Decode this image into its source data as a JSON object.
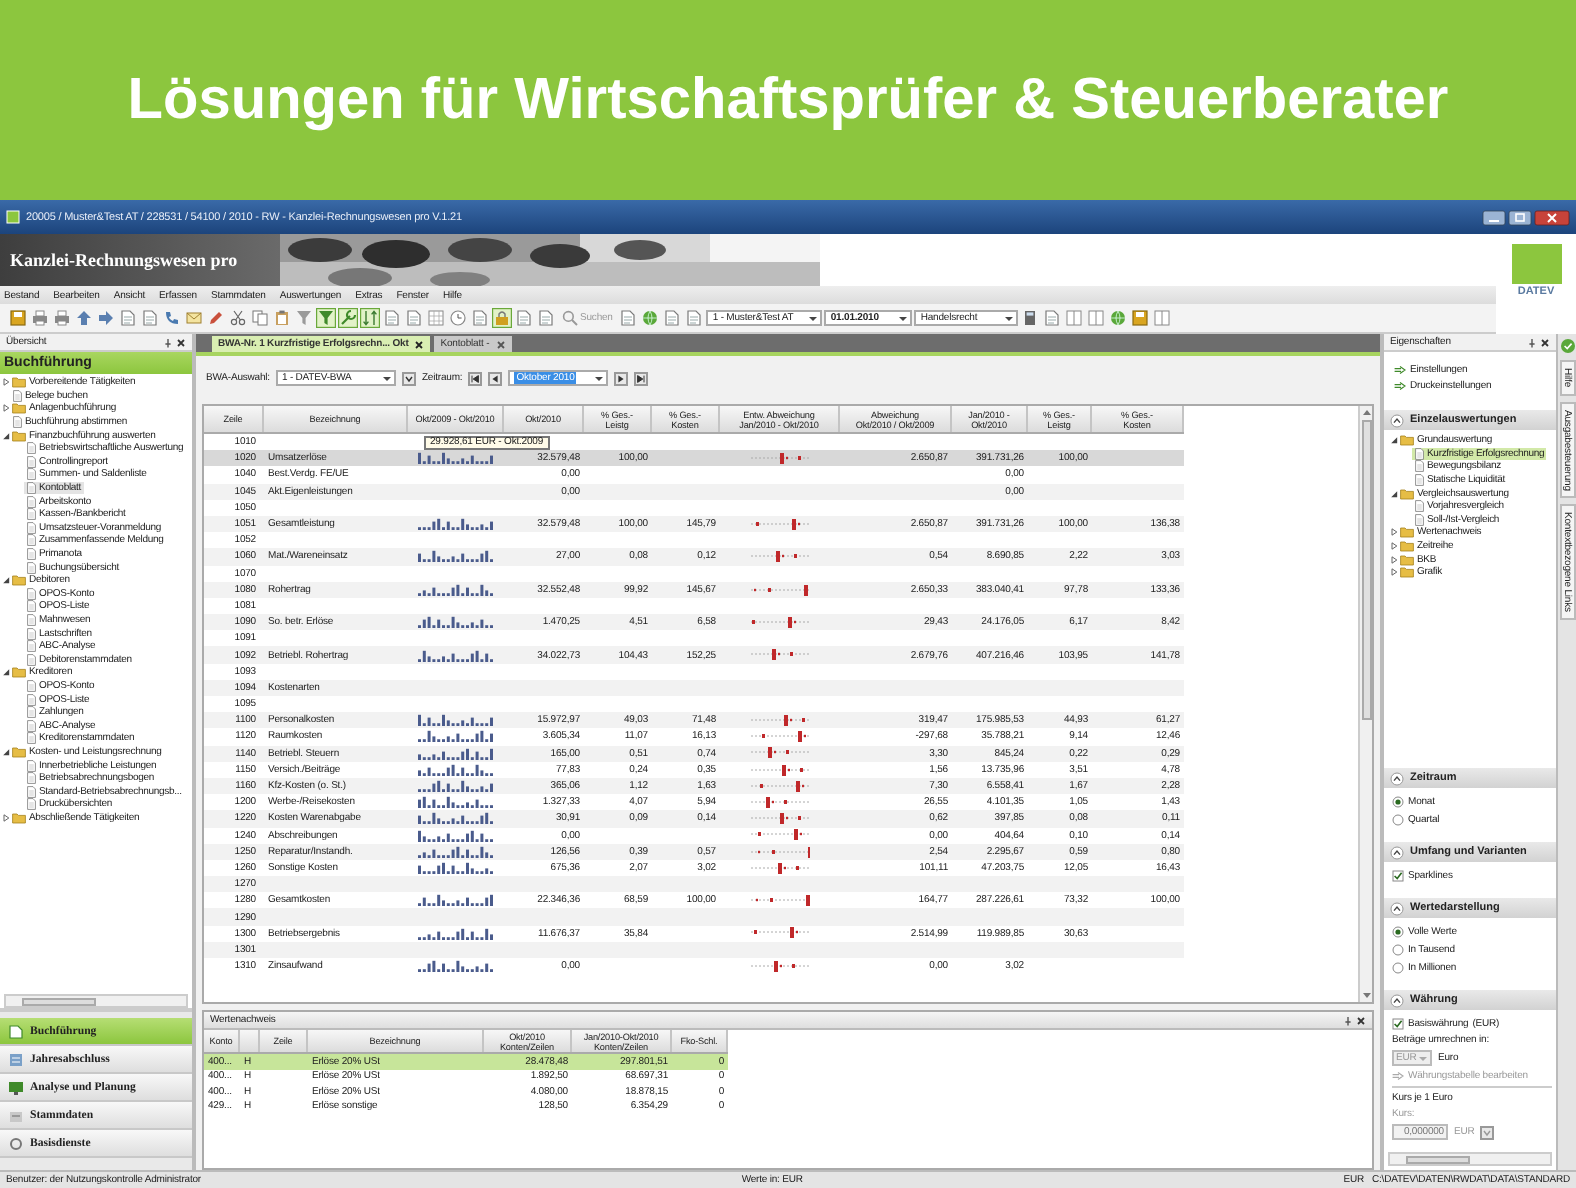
{
  "banner": {
    "title": "Lösungen für Wirtschaftsprüfer & Steuerberater"
  },
  "window": {
    "title": "20005 / Muster&Test AT / 228531 / 54100 / 2010 - RW - Kanzlei-Rechnungswesen pro V.1.21",
    "app_name": "Kanzlei-Rechnungswesen pro",
    "logo_text": "DATEV"
  },
  "menu": [
    "Bestand",
    "Bearbeiten",
    "Ansicht",
    "Erfassen",
    "Stammdaten",
    "Auswertungen",
    "Extras",
    "Fenster",
    "Hilfe"
  ],
  "toolbar": {
    "buttons_left": [
      {
        "on": false
      },
      {
        "on": false
      },
      {
        "on": false
      },
      {
        "on": false
      },
      {
        "on": false
      },
      {
        "on": false
      },
      {
        "on": false
      },
      {
        "on": false
      },
      {
        "on": false
      },
      {
        "on": false
      },
      {
        "on": false
      },
      {
        "on": false
      },
      {
        "on": false
      },
      {
        "on": false
      },
      {
        "on": true
      },
      {
        "on": true
      },
      {
        "on": true
      },
      {
        "on": false
      },
      {
        "on": false
      },
      {
        "on": false
      },
      {
        "on": false
      },
      {
        "on": false
      },
      {
        "on": true
      },
      {
        "on": false
      },
      {
        "on": false
      }
    ],
    "search": "Suchen",
    "buttons_mid": [
      {
        "on": false
      },
      {
        "on": false
      },
      {
        "on": false
      },
      {
        "on": false
      }
    ],
    "combos": [
      "1 - Muster&Test AT",
      "01.01.2010",
      "Handelsrecht"
    ],
    "buttons_right": [
      {
        "on": false
      },
      {
        "on": false
      },
      {
        "on": false
      },
      {
        "on": false
      },
      {
        "on": false
      },
      {
        "on": false
      },
      {
        "on": false
      }
    ]
  },
  "overview": {
    "title": "Übersicht",
    "section": "Buchführung",
    "tree": [
      {
        "label": "Vorbereitende Tätigkeiten",
        "kind": "folder",
        "expanded": false,
        "selected": false
      },
      {
        "label": "Belege buchen",
        "kind": "document",
        "selected": false
      },
      {
        "label": "Anlagenbuchführung",
        "kind": "folder",
        "expanded": false,
        "selected": false
      },
      {
        "label": "Buchführung abstimmen",
        "kind": "document",
        "selected": false
      },
      {
        "label": "Finanzbuchführung auswerten",
        "kind": "folder",
        "expanded": true,
        "selected": false,
        "children": [
          {
            "label": "Betriebswirtschaftliche Auswertung",
            "kind": "document",
            "selected": false
          },
          {
            "label": "Controllingreport",
            "kind": "document",
            "selected": false
          },
          {
            "label": "Summen- und Saldenliste",
            "kind": "document",
            "selected": false
          },
          {
            "label": "Kontoblatt",
            "kind": "document",
            "selected": true
          },
          {
            "label": "Arbeitskonto",
            "kind": "document",
            "selected": false
          },
          {
            "label": "Kassen-/Bankbericht",
            "kind": "document",
            "selected": false
          },
          {
            "label": "Umsatzsteuer-Voranmeldung",
            "kind": "document",
            "selected": false
          },
          {
            "label": "Zusammenfassende Meldung",
            "kind": "document",
            "selected": false
          },
          {
            "label": "Primanota",
            "kind": "document",
            "selected": false
          },
          {
            "label": "Buchungsübersicht",
            "kind": "document",
            "selected": false
          }
        ]
      },
      {
        "label": "Debitoren",
        "kind": "folder",
        "expanded": true,
        "selected": false,
        "children": [
          {
            "label": "OPOS-Konto",
            "kind": "document",
            "selected": false
          },
          {
            "label": "OPOS-Liste",
            "kind": "document",
            "selected": false
          },
          {
            "label": "Mahnwesen",
            "kind": "document",
            "selected": false
          },
          {
            "label": "Lastschriften",
            "kind": "document",
            "selected": false
          },
          {
            "label": "ABC-Analyse",
            "kind": "document",
            "selected": false
          },
          {
            "label": "Debitorenstammdaten",
            "kind": "document",
            "selected": false
          }
        ]
      },
      {
        "label": "Kreditoren",
        "kind": "folder",
        "expanded": true,
        "selected": false,
        "children": [
          {
            "label": "OPOS-Konto",
            "kind": "document",
            "selected": false
          },
          {
            "label": "OPOS-Liste",
            "kind": "document",
            "selected": false
          },
          {
            "label": "Zahlungen",
            "kind": "document",
            "selected": false
          },
          {
            "label": "ABC-Analyse",
            "kind": "document",
            "selected": false
          },
          {
            "label": "Kreditorenstammdaten",
            "kind": "document",
            "selected": false
          }
        ]
      },
      {
        "label": "Kosten- und Leistungsrechnung",
        "kind": "folder",
        "expanded": true,
        "selected": false,
        "children": [
          {
            "label": "Innerbetriebliche Leistungen",
            "kind": "document",
            "selected": false
          },
          {
            "label": "Betriebsabrechnungsbogen",
            "kind": "document",
            "selected": false
          },
          {
            "label": "Standard-Betriebsabrechnungsb...",
            "kind": "document",
            "selected": false
          },
          {
            "label": "Druckübersichten",
            "kind": "document",
            "selected": false
          }
        ]
      },
      {
        "label": "Abschließende Tätigkeiten",
        "kind": "folder",
        "expanded": false,
        "selected": false
      }
    ],
    "nav": [
      {
        "label": "Buchführung",
        "selected": true
      },
      {
        "label": "Jahresabschluss",
        "selected": false
      },
      {
        "label": "Analyse und Planung",
        "selected": false
      },
      {
        "label": "Stammdaten",
        "selected": false
      },
      {
        "label": "Basisdienste",
        "selected": false
      }
    ]
  },
  "tabs": [
    {
      "label": "BWA-Nr. 1 Kurzfristige Erfolgsrechn... Okt",
      "selected": true
    },
    {
      "label": "Kontoblatt -",
      "selected": false
    }
  ],
  "report": {
    "selection_label": "BWA-Auswahl:",
    "selection": "1 - DATEV-BWA",
    "period_label": "Zeitraum:",
    "period": "Oktober 2010",
    "tooltip": "29.928,61 EUR - Okt.2009",
    "columns": [
      "Zeile",
      "Bezeichnung",
      "Okt/2009 - Okt/2010",
      "Okt/2010",
      "% Ges.-\nLeistg",
      "% Ges.-\nKosten",
      "Entw. Abweichung\nJan/2010 - Okt/2010",
      "Abweichung\nOkt/2010 / Okt/2009",
      "Jan/2010 -\nOkt/2010",
      "% Ges.-\nLeistg",
      "% Ges.-\nKosten"
    ],
    "rows": [
      {
        "line": "1010",
        "selected": false,
        "sparkline": false,
        "deviation": false,
        "values": {}
      },
      {
        "line": "1020",
        "label": "Umsatzerlöse",
        "selected": true,
        "sparkline": true,
        "deviation": true,
        "values": {
          "okt": "32.579,48",
          "gl": "100,00",
          "abw": "2.650,87",
          "jan": "391.731,26",
          "gl2": "100,00"
        }
      },
      {
        "line": "1040",
        "label": "Best.Verdg. FE/UE",
        "selected": false,
        "sparkline": false,
        "deviation": false,
        "values": {
          "okt": "0,00",
          "jan": "0,00"
        }
      },
      {
        "line": "1045",
        "label": "Akt.Eigenleistungen",
        "selected": false,
        "sparkline": false,
        "deviation": false,
        "values": {
          "okt": "0,00",
          "jan": "0,00"
        }
      },
      {
        "line": "1050",
        "selected": false,
        "sparkline": false,
        "deviation": false,
        "values": {}
      },
      {
        "line": "1051",
        "label": "Gesamtleistung",
        "selected": false,
        "sparkline": true,
        "deviation": true,
        "values": {
          "okt": "32.579,48",
          "gl": "100,00",
          "gk": "145,79",
          "abw": "2.650,87",
          "jan": "391.731,26",
          "gl2": "100,00",
          "gk2": "136,38"
        }
      },
      {
        "line": "1052",
        "selected": false,
        "sparkline": false,
        "deviation": false,
        "values": {}
      },
      {
        "line": "1060",
        "label": "Mat./Wareneinsatz",
        "selected": false,
        "sparkline": true,
        "deviation": true,
        "values": {
          "okt": "27,00",
          "gl": "0,08",
          "gk": "0,12",
          "abw": "0,54",
          "jan": "8.690,85",
          "gl2": "2,22",
          "gk2": "3,03"
        }
      },
      {
        "line": "1070",
        "selected": false,
        "sparkline": false,
        "deviation": false,
        "values": {}
      },
      {
        "line": "1080",
        "label": "Rohertrag",
        "selected": false,
        "sparkline": true,
        "deviation": true,
        "values": {
          "okt": "32.552,48",
          "gl": "99,92",
          "gk": "145,67",
          "abw": "2.650,33",
          "jan": "383.040,41",
          "gl2": "97,78",
          "gk2": "133,36"
        }
      },
      {
        "line": "1081",
        "selected": false,
        "sparkline": false,
        "deviation": false,
        "values": {}
      },
      {
        "line": "1090",
        "label": "So. betr. Erlöse",
        "selected": false,
        "sparkline": true,
        "deviation": true,
        "values": {
          "okt": "1.470,25",
          "gl": "4,51",
          "gk": "6,58",
          "abw": "29,43",
          "jan": "24.176,05",
          "gl2": "6,17",
          "gk2": "8,42"
        }
      },
      {
        "line": "1091",
        "selected": false,
        "sparkline": false,
        "deviation": false,
        "values": {}
      },
      {
        "line": "1092",
        "label": "Betriebl. Rohertrag",
        "selected": false,
        "sparkline": true,
        "deviation": true,
        "values": {
          "okt": "34.022,73",
          "gl": "104,43",
          "gk": "152,25",
          "abw": "2.679,76",
          "jan": "407.216,46",
          "gl2": "103,95",
          "gk2": "141,78"
        }
      },
      {
        "line": "1093",
        "selected": false,
        "sparkline": false,
        "deviation": false,
        "values": {}
      },
      {
        "line": "1094",
        "label": "Kostenarten",
        "selected": false,
        "sparkline": false,
        "deviation": false,
        "values": {}
      },
      {
        "line": "1095",
        "selected": false,
        "sparkline": false,
        "deviation": false,
        "values": {}
      },
      {
        "line": "1100",
        "label": "Personalkosten",
        "selected": false,
        "sparkline": true,
        "deviation": true,
        "values": {
          "okt": "15.972,97",
          "gl": "49,03",
          "gk": "71,48",
          "abw": "319,47",
          "jan": "175.985,53",
          "gl2": "44,93",
          "gk2": "61,27"
        }
      },
      {
        "line": "1120",
        "label": "Raumkosten",
        "selected": false,
        "sparkline": true,
        "deviation": true,
        "values": {
          "okt": "3.605,34",
          "gl": "11,07",
          "gk": "16,13",
          "abw": "-297,68",
          "jan": "35.788,21",
          "gl2": "9,14",
          "gk2": "12,46"
        }
      },
      {
        "line": "1140",
        "label": "Betriebl. Steuern",
        "selected": false,
        "sparkline": true,
        "deviation": true,
        "values": {
          "okt": "165,00",
          "gl": "0,51",
          "gk": "0,74",
          "abw": "3,30",
          "jan": "845,24",
          "gl2": "0,22",
          "gk2": "0,29"
        }
      },
      {
        "line": "1150",
        "label": "Versich./Beiträge",
        "selected": false,
        "sparkline": true,
        "deviation": true,
        "values": {
          "okt": "77,83",
          "gl": "0,24",
          "gk": "0,35",
          "abw": "1,56",
          "jan": "13.735,96",
          "gl2": "3,51",
          "gk2": "4,78"
        }
      },
      {
        "line": "1160",
        "label": "Kfz-Kosten (o. St.)",
        "selected": false,
        "sparkline": true,
        "deviation": true,
        "values": {
          "okt": "365,06",
          "gl": "1,12",
          "gk": "1,63",
          "abw": "7,30",
          "jan": "6.558,41",
          "gl2": "1,67",
          "gk2": "2,28"
        }
      },
      {
        "line": "1200",
        "label": "Werbe-/Reisekosten",
        "selected": false,
        "sparkline": true,
        "deviation": true,
        "values": {
          "okt": "1.327,33",
          "gl": "4,07",
          "gk": "5,94",
          "abw": "26,55",
          "jan": "4.101,35",
          "gl2": "1,05",
          "gk2": "1,43"
        }
      },
      {
        "line": "1220",
        "label": "Kosten Warenabgabe",
        "selected": false,
        "sparkline": true,
        "deviation": true,
        "values": {
          "okt": "30,91",
          "gl": "0,09",
          "gk": "0,14",
          "abw": "0,62",
          "jan": "397,85",
          "gl2": "0,08",
          "gk2": "0,11"
        }
      },
      {
        "line": "1240",
        "label": "Abschreibungen",
        "selected": false,
        "sparkline": true,
        "deviation": true,
        "values": {
          "okt": "0,00",
          "abw": "0,00",
          "jan": "404,64",
          "gl2": "0,10",
          "gk2": "0,14"
        }
      },
      {
        "line": "1250",
        "label": "Reparatur/Instandh.",
        "selected": false,
        "sparkline": true,
        "deviation": true,
        "values": {
          "okt": "126,56",
          "gl": "0,39",
          "gk": "0,57",
          "abw": "2,54",
          "jan": "2.295,67",
          "gl2": "0,59",
          "gk2": "0,80"
        }
      },
      {
        "line": "1260",
        "label": "Sonstige Kosten",
        "selected": false,
        "sparkline": true,
        "deviation": true,
        "values": {
          "okt": "675,36",
          "gl": "2,07",
          "gk": "3,02",
          "abw": "101,11",
          "jan": "47.203,75",
          "gl2": "12,05",
          "gk2": "16,43"
        }
      },
      {
        "line": "1270",
        "selected": false,
        "sparkline": false,
        "deviation": false,
        "values": {}
      },
      {
        "line": "1280",
        "label": "Gesamtkosten",
        "selected": false,
        "sparkline": true,
        "deviation": true,
        "values": {
          "okt": "22.346,36",
          "gl": "68,59",
          "gk": "100,00",
          "abw": "164,77",
          "jan": "287.226,61",
          "gl2": "73,32",
          "gk2": "100,00"
        }
      },
      {
        "line": "1290",
        "selected": false,
        "sparkline": false,
        "deviation": false,
        "values": {}
      },
      {
        "line": "1300",
        "label": "Betriebsergebnis",
        "selected": false,
        "sparkline": true,
        "deviation": true,
        "values": {
          "okt": "11.676,37",
          "gl": "35,84",
          "abw": "2.514,99",
          "jan": "119.989,85",
          "gl2": "30,63"
        }
      },
      {
        "line": "1301",
        "selected": false,
        "sparkline": false,
        "deviation": false,
        "values": {}
      },
      {
        "line": "1310",
        "label": "Zinsaufwand",
        "selected": false,
        "sparkline": true,
        "deviation": true,
        "values": {
          "okt": "0,00",
          "abw": "0,00",
          "jan": "3,02"
        }
      }
    ]
  },
  "values_panel": {
    "title": "Wertenachweis",
    "columns": [
      "Konto",
      "Zeile",
      "Bezeichnung",
      "Okt/2010\nKonten/Zeilen",
      "Jan/2010-Okt/2010\nKonten/Zeilen",
      "Fko-Schl."
    ],
    "rows": [
      {
        "selected": true,
        "values": {
          "konto": "400...",
          "side": "H",
          "label": "Erlöse 20% USt",
          "okt": "28.478,48",
          "jan": "297.801,51",
          "fko": "0"
        }
      },
      {
        "selected": false,
        "values": {
          "konto": "400...",
          "side": "H",
          "label": "Erlöse 20% USt",
          "okt": "1.892,50",
          "jan": "68.697,31",
          "fko": "0"
        }
      },
      {
        "selected": false,
        "values": {
          "konto": "400...",
          "side": "H",
          "label": "Erlöse 20% USt",
          "okt": "4.080,00",
          "jan": "18.878,15",
          "fko": "0"
        }
      },
      {
        "selected": false,
        "values": {
          "konto": "429...",
          "side": "H",
          "label": "Erlöse sonstige",
          "okt": "128,50",
          "jan": "6.354,29",
          "fko": "0"
        }
      }
    ]
  },
  "properties": {
    "title": "Eigenschaften",
    "links": [
      "Einstellungen",
      "Druckeinstellungen"
    ],
    "sections": [
      {
        "kind": "tree",
        "title": "Einzelauswertungen",
        "expanded": true,
        "tree": [
          {
            "label": "Grundauswertung",
            "kind": "folder",
            "expanded": true,
            "selected": false,
            "children": [
              {
                "label": "Kurzfristige Erfolgsrechnung",
                "kind": "document",
                "selected": true
              },
              {
                "label": "Bewegungsbilanz",
                "kind": "document",
                "selected": false
              },
              {
                "label": "Statische Liquidität",
                "kind": "document",
                "selected": false
              }
            ]
          },
          {
            "label": "Vergleichsauswertung",
            "kind": "folder",
            "expanded": true,
            "selected": false,
            "children": [
              {
                "label": "Vorjahresvergleich",
                "kind": "document",
                "selected": false
              },
              {
                "label": "Soll-/Ist-Vergleich",
                "kind": "document",
                "selected": false
              }
            ]
          },
          {
            "label": "Wertenachweis",
            "kind": "folder",
            "expanded": false,
            "selected": false
          },
          {
            "label": "Zeitreihe",
            "kind": "folder",
            "expanded": false,
            "selected": false
          },
          {
            "label": "BKB",
            "kind": "folder",
            "expanded": false,
            "selected": false
          },
          {
            "label": "Grafik",
            "kind": "folder",
            "expanded": false,
            "selected": false
          }
        ]
      },
      {
        "kind": "radio",
        "title": "Zeitraum",
        "expanded": true,
        "options": [
          {
            "label": "Monat",
            "selected": true
          },
          {
            "label": "Quartal",
            "selected": false
          }
        ]
      },
      {
        "kind": "check",
        "title": "Umfang und Varianten",
        "expanded": true,
        "options": [
          {
            "label": "Sparklines",
            "checked": true
          }
        ]
      },
      {
        "kind": "radio",
        "title": "Wertedarstellung",
        "expanded": true,
        "options": [
          {
            "label": "Volle Werte",
            "selected": true
          },
          {
            "label": "In Tausend",
            "selected": false
          },
          {
            "label": "In Millionen",
            "selected": false
          }
        ]
      },
      {
        "kind": "currency",
        "title": "Währung",
        "expanded": true,
        "base_label": "Basiswährung",
        "base_checked": true,
        "base_code": "(EUR)",
        "convert_label": "Beträge umrechnen in:",
        "currency": "EUR",
        "currency_name": "Euro",
        "table_link": "Währungstabelle bearbeiten",
        "rate_group": "Kurs je 1 Euro",
        "rate_label": "Kurs:",
        "rate": "0,000000",
        "rate_unit": "EUR"
      }
    ],
    "side_tabs": [
      "Hilfe",
      "Ausgabesteuerung",
      "Kontextbezogene Links"
    ]
  },
  "status_bar": {
    "user": "Benutzer: der Nutzungskontrolle Administrator",
    "values": "Werte in: EUR",
    "currency": "EUR",
    "path": "C:\\DATEV\\DATEN\\RWDAT\\DATA\\STANDARD"
  }
}
